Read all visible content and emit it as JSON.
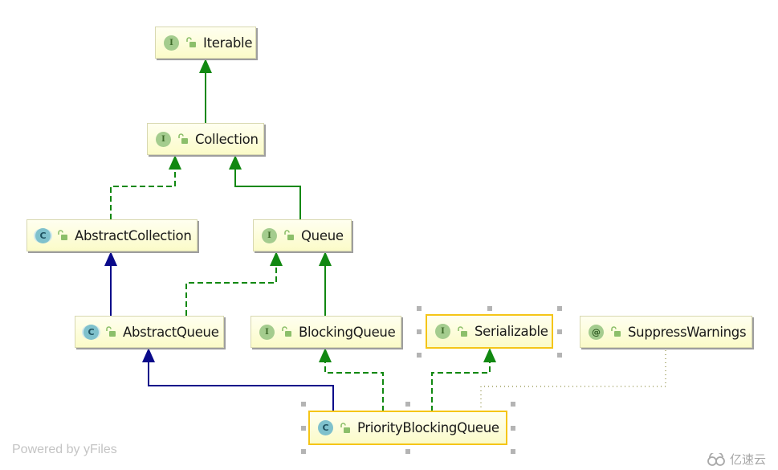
{
  "diagram": {
    "nodes": [
      {
        "id": "iterable",
        "label": "Iterable",
        "kind": "interface",
        "kind_glyph": "I",
        "selected": false
      },
      {
        "id": "collection",
        "label": "Collection",
        "kind": "interface",
        "kind_glyph": "I",
        "selected": false
      },
      {
        "id": "abstract-collection",
        "label": "AbstractCollection",
        "kind": "abstract-class",
        "kind_glyph": "C",
        "selected": false
      },
      {
        "id": "queue",
        "label": "Queue",
        "kind": "interface",
        "kind_glyph": "I",
        "selected": false
      },
      {
        "id": "abstract-queue",
        "label": "AbstractQueue",
        "kind": "abstract-class",
        "kind_glyph": "C",
        "selected": false
      },
      {
        "id": "blocking-queue",
        "label": "BlockingQueue",
        "kind": "interface",
        "kind_glyph": "I",
        "selected": false
      },
      {
        "id": "serializable",
        "label": "Serializable",
        "kind": "interface",
        "kind_glyph": "I",
        "selected": true
      },
      {
        "id": "suppress-warnings",
        "label": "SuppressWarnings",
        "kind": "annotation",
        "kind_glyph": "@",
        "selected": false
      },
      {
        "id": "priority-blocking-queue",
        "label": "PriorityBlockingQueue",
        "kind": "class",
        "kind_glyph": "C",
        "selected": true
      }
    ],
    "edges": [
      {
        "from": "collection",
        "to": "iterable",
        "type": "extends-interface",
        "style": "solid",
        "color": "#118811"
      },
      {
        "from": "abstract-collection",
        "to": "collection",
        "type": "implements",
        "style": "dashed",
        "color": "#118811"
      },
      {
        "from": "queue",
        "to": "collection",
        "type": "extends-interface",
        "style": "solid",
        "color": "#118811"
      },
      {
        "from": "abstract-queue",
        "to": "abstract-collection",
        "type": "extends",
        "style": "solid",
        "color": "#0a0a8a"
      },
      {
        "from": "abstract-queue",
        "to": "queue",
        "type": "implements",
        "style": "dashed",
        "color": "#118811"
      },
      {
        "from": "blocking-queue",
        "to": "queue",
        "type": "extends-interface",
        "style": "solid",
        "color": "#118811"
      },
      {
        "from": "priority-blocking-queue",
        "to": "abstract-queue",
        "type": "extends",
        "style": "solid",
        "color": "#0a0a8a"
      },
      {
        "from": "priority-blocking-queue",
        "to": "blocking-queue",
        "type": "implements",
        "style": "dashed",
        "color": "#118811"
      },
      {
        "from": "priority-blocking-queue",
        "to": "serializable",
        "type": "implements",
        "style": "dashed",
        "color": "#118811"
      },
      {
        "from": "priority-blocking-queue",
        "to": "suppress-warnings",
        "type": "annotated-with",
        "style": "dotted",
        "color": "#a0a060"
      }
    ]
  },
  "footer": {
    "text": "Powered by yFiles"
  },
  "watermark": {
    "text": "亿速云"
  }
}
